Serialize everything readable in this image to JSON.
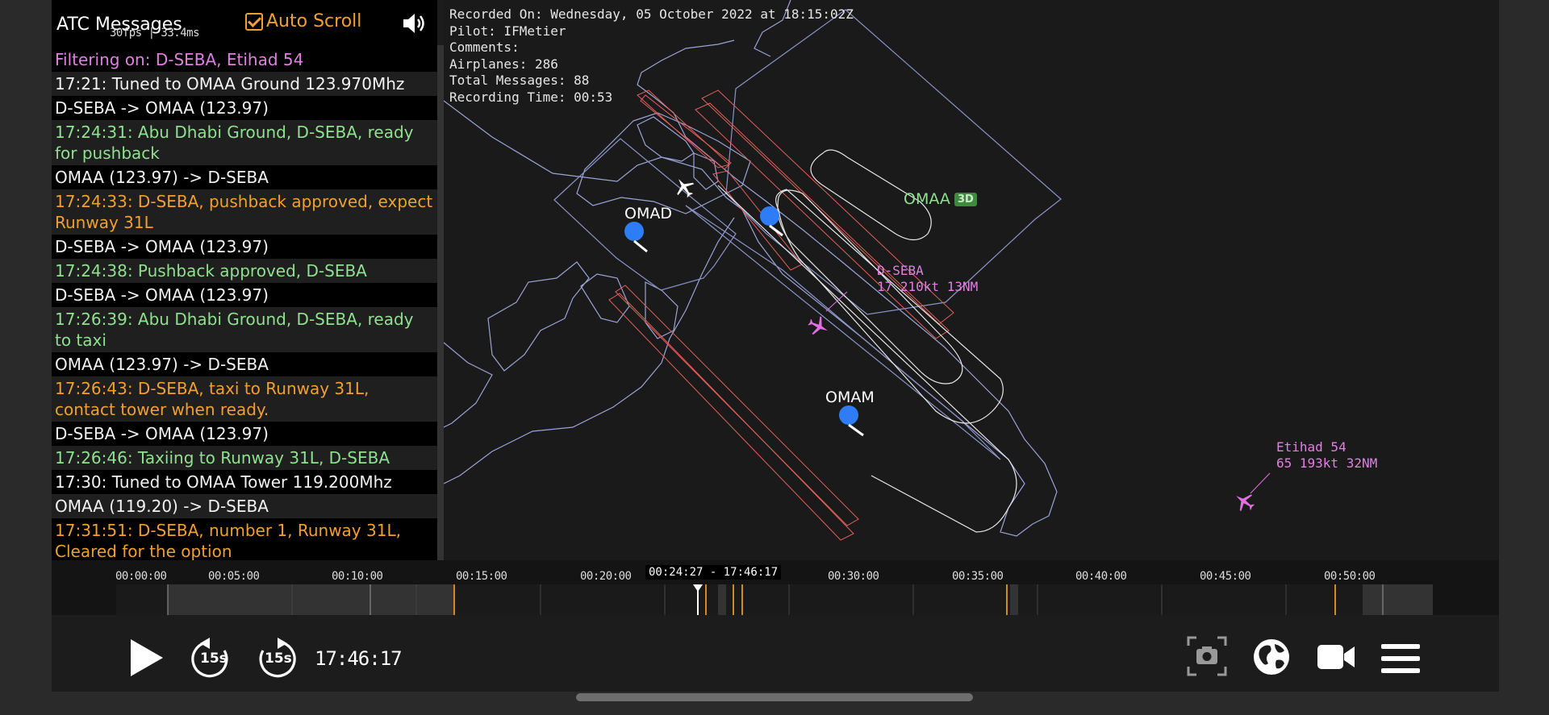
{
  "atc": {
    "title": "ATC Messages",
    "fps": "30fps | 33.4ms",
    "autoscroll_label": "Auto Scroll",
    "messages": [
      {
        "text": "Filtering on: D-SEBA, Etihad 54",
        "color": "#e080e0"
      },
      {
        "text": "17:21: Tuned to OMAA Ground 123.970Mhz",
        "color": "#f2f2f2"
      },
      {
        "text": "D-SEBA -> OMAA (123.97)",
        "color": "#f2f2f2"
      },
      {
        "text": "17:24:31: Abu Dhabi Ground, D-SEBA, ready for pushback",
        "color": "#8fe08f"
      },
      {
        "text": "OMAA (123.97) -> D-SEBA",
        "color": "#f2f2f2"
      },
      {
        "text": "17:24:33: D-SEBA, pushback approved, expect Runway 31L",
        "color": "#f0a030"
      },
      {
        "text": "D-SEBA -> OMAA (123.97)",
        "color": "#f2f2f2"
      },
      {
        "text": "17:24:38: Pushback approved, D-SEBA",
        "color": "#8fe08f"
      },
      {
        "text": "D-SEBA -> OMAA (123.97)",
        "color": "#f2f2f2"
      },
      {
        "text": "17:26:39: Abu Dhabi Ground, D-SEBA, ready to taxi",
        "color": "#8fe08f"
      },
      {
        "text": "OMAA (123.97) -> D-SEBA",
        "color": "#f2f2f2"
      },
      {
        "text": "17:26:43: D-SEBA, taxi to Runway 31L, contact tower when ready.",
        "color": "#f0a030"
      },
      {
        "text": "D-SEBA -> OMAA (123.97)",
        "color": "#f2f2f2"
      },
      {
        "text": "17:26:46: Taxiing to Runway 31L, D-SEBA",
        "color": "#8fe08f"
      },
      {
        "text": "17:30: Tuned to OMAA Tower 119.200Mhz",
        "color": "#f2f2f2"
      },
      {
        "text": "OMAA (119.20) -> D-SEBA",
        "color": "#f2f2f2"
      },
      {
        "text": "17:31:51: D-SEBA, number 1, Runway 31L, Cleared for the option",
        "color": "#f0a030"
      }
    ]
  },
  "recording": {
    "recorded_on": "Recorded On: Wednesday, 05 October 2022 at 18:15:02Z",
    "pilot": "Pilot: IFMetier",
    "comments": "Comments:",
    "airplanes": "Airplanes: 286",
    "total_messages": "Total Messages: 88",
    "recording_time": "Recording Time: 00:53"
  },
  "map": {
    "airports": {
      "omad": "OMAD",
      "omaa": "OMAA",
      "omam": "OMAM"
    },
    "badge_3d": "3D",
    "aircraft": {
      "dseba": {
        "name": "D-SEBA",
        "info": "17 210kt 13NM"
      },
      "etihad": {
        "name": "Etihad 54",
        "info": "65 193kt 32NM"
      }
    },
    "colors": {
      "coast": "#9aa3d6",
      "runway_cone": "#e0605a",
      "airport_dot": "#2f7df6",
      "tracked_aircraft": "#e070e0"
    }
  },
  "timeline": {
    "ticks": [
      "00:00:00",
      "00:05:00",
      "00:10:00",
      "00:15:00",
      "00:20:00",
      "00:30:00",
      "00:35:00",
      "00:40:00",
      "00:45:00",
      "00:50:00"
    ],
    "range_tooltip": "00:24:27 - 17:46:17",
    "playhead_fraction": 0.462
  },
  "controls": {
    "back_label": "15s",
    "forward_label": "15s",
    "time": "17:46:17",
    "icons": [
      "play-icon",
      "rewind-15-icon",
      "forward-15-icon",
      "screenshot-icon",
      "globe-icon",
      "camera-icon",
      "menu-icon"
    ]
  }
}
